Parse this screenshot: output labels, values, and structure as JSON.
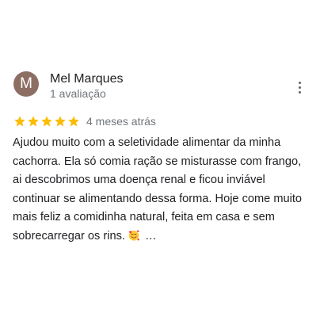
{
  "review": {
    "avatar_letter": "M",
    "reviewer_name": "Mel Marques",
    "review_count": "1 avaliação",
    "rating": 5,
    "date": "4 meses atrás",
    "text_lines": [
      "Ajudou muito com a seletividade alimentar da minha",
      "cachorra. Ela só comia ração se misturasse com frango,",
      "ai descobrimos uma doença renal e ficou inviável",
      "continuar se alimentando dessa forma. Hoje come muito",
      "mais feliz a comidinha natural, feita em casa e sem",
      "sobrecarregar os rins."
    ],
    "emoji": "smiling-face-with-hearts-icon",
    "truncation": "…",
    "more_icon": "more-vert-icon"
  },
  "colors": {
    "avatar_bg": "#8d6e63",
    "star": "#fbbc04",
    "name": "#202124",
    "secondary": "#70757a"
  }
}
